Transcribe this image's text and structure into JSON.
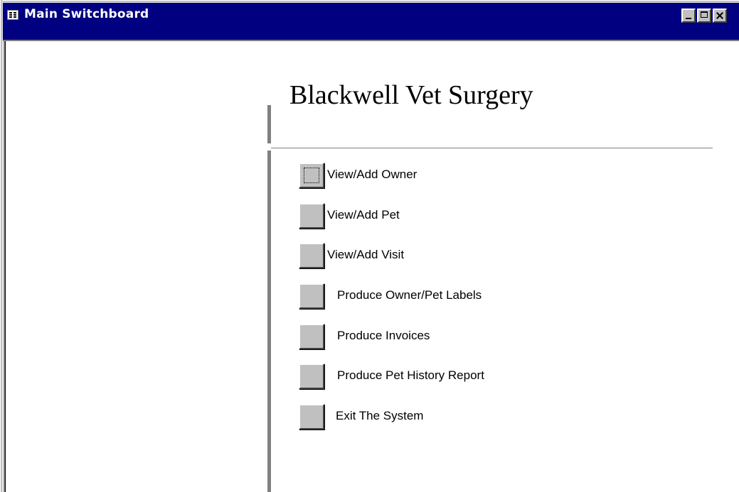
{
  "window": {
    "title": "Main Switchboard",
    "controls": {
      "minimize_icon": "minimize-icon",
      "maximize_icon": "maximize-icon",
      "close_icon": "close-icon"
    },
    "colors": {
      "titlebar": "#000080",
      "face": "#c0c0c0",
      "divider": "#808080"
    }
  },
  "switchboard": {
    "heading": "Blackwell Vet Surgery",
    "items": [
      {
        "label": "View/Add Owner",
        "focused": true
      },
      {
        "label": "View/Add Pet"
      },
      {
        "label": "View/Add Visit"
      },
      {
        "label": "Produce Owner/Pet Labels"
      },
      {
        "label": "Produce Invoices"
      },
      {
        "label": "Produce Pet History Report"
      },
      {
        "label": "Exit The System"
      }
    ]
  }
}
